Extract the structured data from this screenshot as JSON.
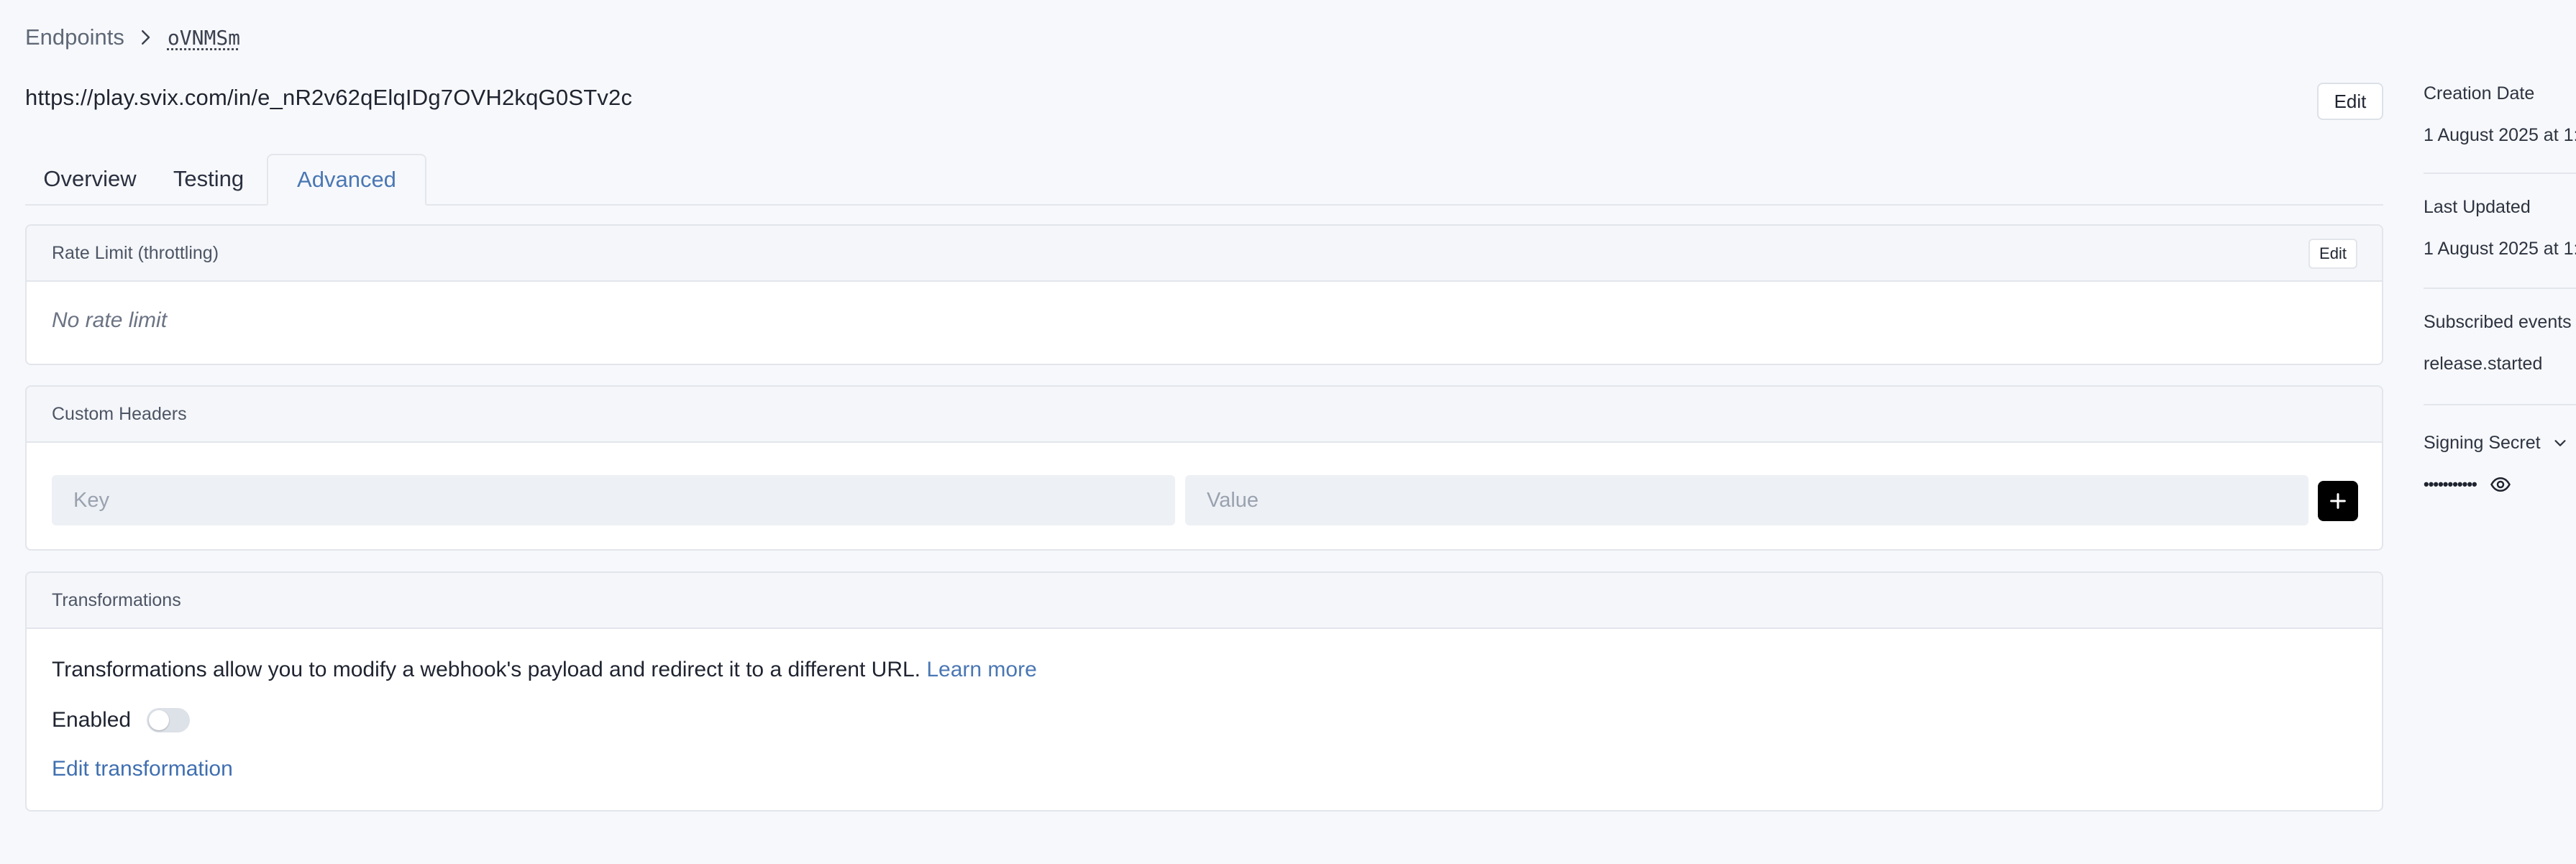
{
  "breadcrumb": {
    "parent": "Endpoints",
    "current": "oVNMSm"
  },
  "endpoint": {
    "url": "https://play.svix.com/in/e_nR2v62qElqIDg7OVH2kqG0STv2c",
    "edit_label": "Edit"
  },
  "tabs": [
    {
      "label": "Overview",
      "active": false
    },
    {
      "label": "Testing",
      "active": false
    },
    {
      "label": "Advanced",
      "active": true
    }
  ],
  "rate_limit": {
    "title": "Rate Limit (throttling)",
    "edit_label": "Edit",
    "value": "No rate limit"
  },
  "custom_headers": {
    "title": "Custom Headers",
    "key_placeholder": "Key",
    "value_placeholder": "Value",
    "key_value": "",
    "value_value": "",
    "add_icon": "plus-icon"
  },
  "transformations": {
    "title": "Transformations",
    "description": "Transformations allow you to modify a webhook's payload and redirect it to a different URL.",
    "learn_more": "Learn more",
    "enabled_label": "Enabled",
    "enabled": false,
    "edit_link": "Edit transformation"
  },
  "sidebar": {
    "creation_date_label": "Creation Date",
    "creation_date_value": "1 August 2025 at 1:",
    "last_updated_label": "Last Updated",
    "last_updated_value": "1 August 2025 at 1:",
    "subscribed_events_label": "Subscribed events",
    "subscribed_events_value": "release.started",
    "signing_secret_label": "Signing Secret",
    "signing_secret_masked": "•••••••••••",
    "icons": [
      "chevron-down-icon",
      "eye-icon"
    ]
  },
  "colors": {
    "background": "#f7f8fb",
    "accent": "#4a77b4",
    "card_header": "#f4f6f9",
    "border": "#e2e5eb",
    "input_fill": "#edf0f4"
  }
}
